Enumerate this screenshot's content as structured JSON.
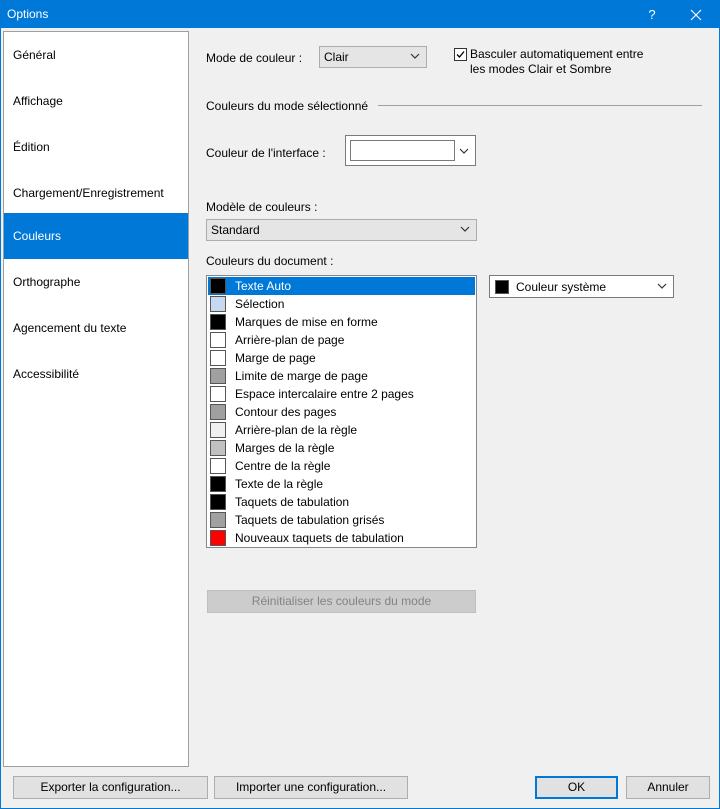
{
  "window": {
    "title": "Options",
    "help_glyph": "?"
  },
  "sidebar": {
    "items": [
      {
        "label": "Général"
      },
      {
        "label": "Affichage"
      },
      {
        "label": "Édition"
      },
      {
        "label": "Chargement/Enregistrement"
      },
      {
        "label": "Couleurs",
        "active": true
      },
      {
        "label": "Orthographe"
      },
      {
        "label": "Agencement du texte"
      },
      {
        "label": "Accessibilité"
      }
    ]
  },
  "main": {
    "color_mode_label": "Mode de couleur :",
    "color_mode_value": "Clair",
    "auto_switch_checked": true,
    "auto_switch_line1": "Basculer automatiquement entre",
    "auto_switch_line2": "les modes Clair et Sombre",
    "group_title": "Couleurs du mode sélectionné",
    "interface_color_label": "Couleur de l'interface :",
    "interface_color_value": "#ffffff",
    "model_label": "Modèle de couleurs :",
    "model_value": "Standard",
    "doc_colors_label": "Couleurs du document :",
    "doc_colors": [
      {
        "label": "Texte Auto",
        "color": "#000000",
        "selected": true
      },
      {
        "label": "Sélection",
        "color": "#c6d9f1"
      },
      {
        "label": "Marques de mise en forme",
        "color": "#000000"
      },
      {
        "label": "Arrière-plan de page",
        "color": "#ffffff"
      },
      {
        "label": "Marge de page",
        "color": "#ffffff"
      },
      {
        "label": "Limite de marge de page",
        "color": "#a0a0a0"
      },
      {
        "label": "Espace intercalaire entre 2 pages",
        "color": "#ffffff"
      },
      {
        "label": "Contour des pages",
        "color": "#a0a0a0"
      },
      {
        "label": "Arrière-plan de la règle",
        "color": "#f0f0f0"
      },
      {
        "label": "Marges de la règle",
        "color": "#c0c0c0"
      },
      {
        "label": "Centre de la règle",
        "color": "#ffffff"
      },
      {
        "label": "Texte de la règle",
        "color": "#000000"
      },
      {
        "label": "Taquets de tabulation",
        "color": "#000000"
      },
      {
        "label": "Taquets de tabulation grisés",
        "color": "#a0a0a0"
      },
      {
        "label": "Nouveaux taquets de tabulation",
        "color": "#ff0000"
      }
    ],
    "selected_color_value": "Couleur système",
    "selected_color_swatch": "#000000",
    "reset_button": "Réinitialiser les couleurs du mode"
  },
  "footer": {
    "export_button": "Exporter la configuration...",
    "import_button": "Importer une configuration...",
    "ok_button": "OK",
    "cancel_button": "Annuler"
  },
  "colors": {
    "accent": "#0078d7"
  }
}
